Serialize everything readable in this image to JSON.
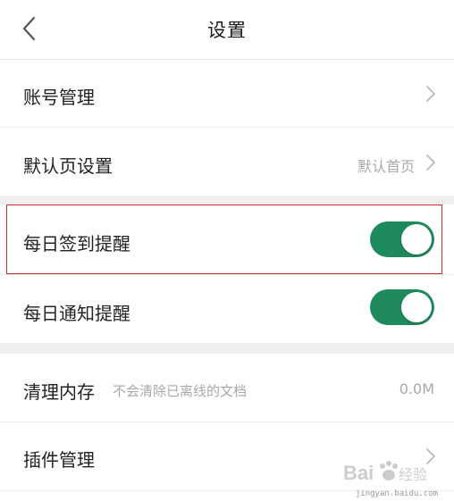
{
  "header": {
    "title": "设置",
    "back_icon": "chevron-left-icon"
  },
  "rows": {
    "account": {
      "label": "账号管理"
    },
    "default_page": {
      "label": "默认页设置",
      "value": "默认首页"
    },
    "sign_in_reminder": {
      "label": "每日签到提醒",
      "toggle_on": true
    },
    "notify_reminder": {
      "label": "每日通知提醒",
      "toggle_on": true
    },
    "clear_cache": {
      "label": "清理内存",
      "hint": "不会清除已离线的文档",
      "size": "0.0M"
    },
    "plugins": {
      "label": "插件管理"
    }
  },
  "watermark": {
    "logo_text": "Bai 经验",
    "url": "jingyan.baidu.com"
  },
  "colors": {
    "toggle_on": "#1f8a5b",
    "highlight_border": "#c9302c",
    "secondary_text": "#a8a8a8",
    "section_gap": "#f0efed"
  }
}
